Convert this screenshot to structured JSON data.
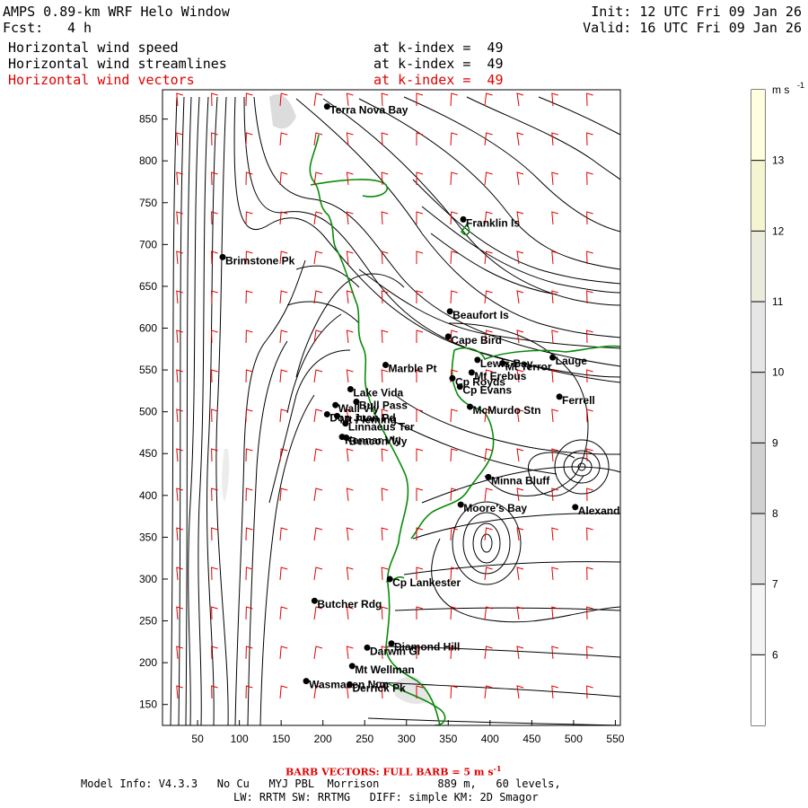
{
  "header": {
    "title": "AMPS 0.89-km WRF Helo Window",
    "fcst_label": "Fcst:",
    "fcst_value": "4 h",
    "init": "Init: 12 UTC Fri 09 Jan 26",
    "valid": "Valid: 16 UTC Fri 09 Jan 26",
    "fields": [
      {
        "name": "Horizontal wind speed",
        "level": "at k-index =  49",
        "color": "#000000"
      },
      {
        "name": "Horizontal wind streamlines",
        "level": "at k-index =  49",
        "color": "#000000"
      },
      {
        "name": "Horizontal wind vectors",
        "level": "at k-index =  49",
        "color": "#e00000"
      }
    ]
  },
  "colorbar": {
    "unit": "m s",
    "unit_exp": "-1",
    "levels": [
      "13",
      "12",
      "11",
      "10",
      "9",
      "8",
      "7",
      "6"
    ],
    "colors": [
      "#ffffe0",
      "#f5f5d2",
      "#ececdc",
      "#e6e6e6",
      "#dcdcdc",
      "#d2d2d2",
      "#e0e0e0",
      "#f4f4f4"
    ]
  },
  "axes": {
    "x_ticks": [
      "50",
      "100",
      "150",
      "200",
      "250",
      "300",
      "350",
      "400",
      "450",
      "500",
      "550"
    ],
    "y_ticks": [
      "850",
      "800",
      "750",
      "700",
      "650",
      "600",
      "550",
      "500",
      "450",
      "400",
      "350",
      "300",
      "250",
      "200",
      "150"
    ]
  },
  "locations": [
    {
      "name": "Terra Nova Bay",
      "x": 205,
      "y": 865
    },
    {
      "name": "Franklin Is",
      "x": 368,
      "y": 730
    },
    {
      "name": "Brimstone Pk",
      "x": 80,
      "y": 685
    },
    {
      "name": "Beaufort Is",
      "x": 352,
      "y": 620
    },
    {
      "name": "Cape Bird",
      "x": 350,
      "y": 590
    },
    {
      "name": "Lewis Bay",
      "x": 385,
      "y": 562
    },
    {
      "name": "Lauge",
      "x": 475,
      "y": 565
    },
    {
      "name": "Mt Terror",
      "x": 415,
      "y": 558
    },
    {
      "name": "Marble Pt",
      "x": 275,
      "y": 556
    },
    {
      "name": "Cp Royds",
      "x": 355,
      "y": 540
    },
    {
      "name": "Mt Erebus",
      "x": 378,
      "y": 547
    },
    {
      "name": "Cp Evans",
      "x": 364,
      "y": 530
    },
    {
      "name": "Lake Vida",
      "x": 233,
      "y": 527
    },
    {
      "name": "Ferrell",
      "x": 483,
      "y": 518
    },
    {
      "name": "Wall Vly",
      "x": 215,
      "y": 508
    },
    {
      "name": "McMurdo Stn",
      "x": 376,
      "y": 506
    },
    {
      "name": "Bull Pass",
      "x": 240,
      "y": 512
    },
    {
      "name": "Don Juan Pd",
      "x": 205,
      "y": 497
    },
    {
      "name": "Mt Fleming",
      "x": 217,
      "y": 495
    },
    {
      "name": "Linnaeus Ter",
      "x": 227,
      "y": 486
    },
    {
      "name": "Kennar Vly",
      "x": 223,
      "y": 470
    },
    {
      "name": "Beacon Vly",
      "x": 228,
      "y": 469
    },
    {
      "name": "Minna Bluff",
      "x": 398,
      "y": 422
    },
    {
      "name": "Moore's Bay",
      "x": 365,
      "y": 389
    },
    {
      "name": "Alexander",
      "x": 502,
      "y": 386
    },
    {
      "name": "Cp Lankester",
      "x": 280,
      "y": 300
    },
    {
      "name": "Butcher Rdg",
      "x": 190,
      "y": 274
    },
    {
      "name": "Darwin Gl",
      "x": 253,
      "y": 218
    },
    {
      "name": "Diamond Hill",
      "x": 282,
      "y": 223
    },
    {
      "name": "Mt Wellman",
      "x": 235,
      "y": 196
    },
    {
      "name": "Wasmasen Nun",
      "x": 180,
      "y": 178
    },
    {
      "name": "Derrick Pk",
      "x": 232,
      "y": 174
    }
  ],
  "footer": {
    "barb_note": "BARB VECTORS:  FULL BARB = 5 m s",
    "barb_exp": "-1",
    "model_info": "Model Info: V4.3.3   No Cu   MYJ PBL  Morrison         889 m,   60 levels,",
    "physics": "LW: RRTM SW: RRTMG   DIFF: simple KM: 2D Smagor"
  }
}
